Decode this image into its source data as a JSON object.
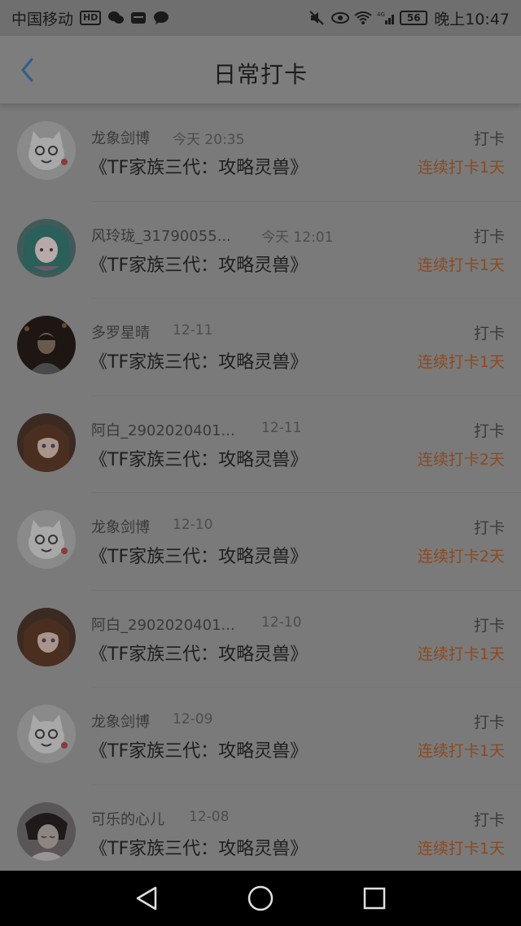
{
  "status_bar": {
    "carrier": "中国移动",
    "hd_badge": "HD",
    "battery": "56",
    "time": "晚上10:47",
    "network": "4G"
  },
  "header": {
    "title": "日常打卡"
  },
  "colors": {
    "accent_back": "#2e5f8a",
    "streak": "#8a4a22"
  },
  "items": [
    {
      "user": "龙象剑博",
      "time": "今天 20:35",
      "action": "打卡",
      "task": "《TF家族三代：攻略灵兽》",
      "streak": "连续打卡1天",
      "avatar": "cat-avatar"
    },
    {
      "user": "风玲珑_31790055...",
      "time": "今天 12:01",
      "action": "打卡",
      "task": "《TF家族三代：攻略灵兽》",
      "streak": "连续打卡1天",
      "avatar": "anime-girl-avatar"
    },
    {
      "user": "多罗星晴",
      "time": "12-11",
      "action": "打卡",
      "task": "《TF家族三代：攻略灵兽》",
      "streak": "连续打卡1天",
      "avatar": "photo-avatar"
    },
    {
      "user": "阿白_2902020401...",
      "time": "12-11",
      "action": "打卡",
      "task": "《TF家族三代：攻略灵兽》",
      "streak": "连续打卡2天",
      "avatar": "brown-hair-avatar"
    },
    {
      "user": "龙象剑博",
      "time": "12-10",
      "action": "打卡",
      "task": "《TF家族三代：攻略灵兽》",
      "streak": "连续打卡2天",
      "avatar": "cat-avatar"
    },
    {
      "user": "阿白_2902020401...",
      "time": "12-10",
      "action": "打卡",
      "task": "《TF家族三代：攻略灵兽》",
      "streak": "连续打卡1天",
      "avatar": "brown-hair-avatar"
    },
    {
      "user": "龙象剑博",
      "time": "12-09",
      "action": "打卡",
      "task": "《TF家族三代：攻略灵兽》",
      "streak": "连续打卡1天",
      "avatar": "cat-avatar"
    },
    {
      "user": "可乐的心儿",
      "time": "12-08",
      "action": "打卡",
      "task": "《TF家族三代：攻略灵兽》",
      "streak": "连续打卡1天",
      "avatar": "portrait-avatar"
    }
  ]
}
